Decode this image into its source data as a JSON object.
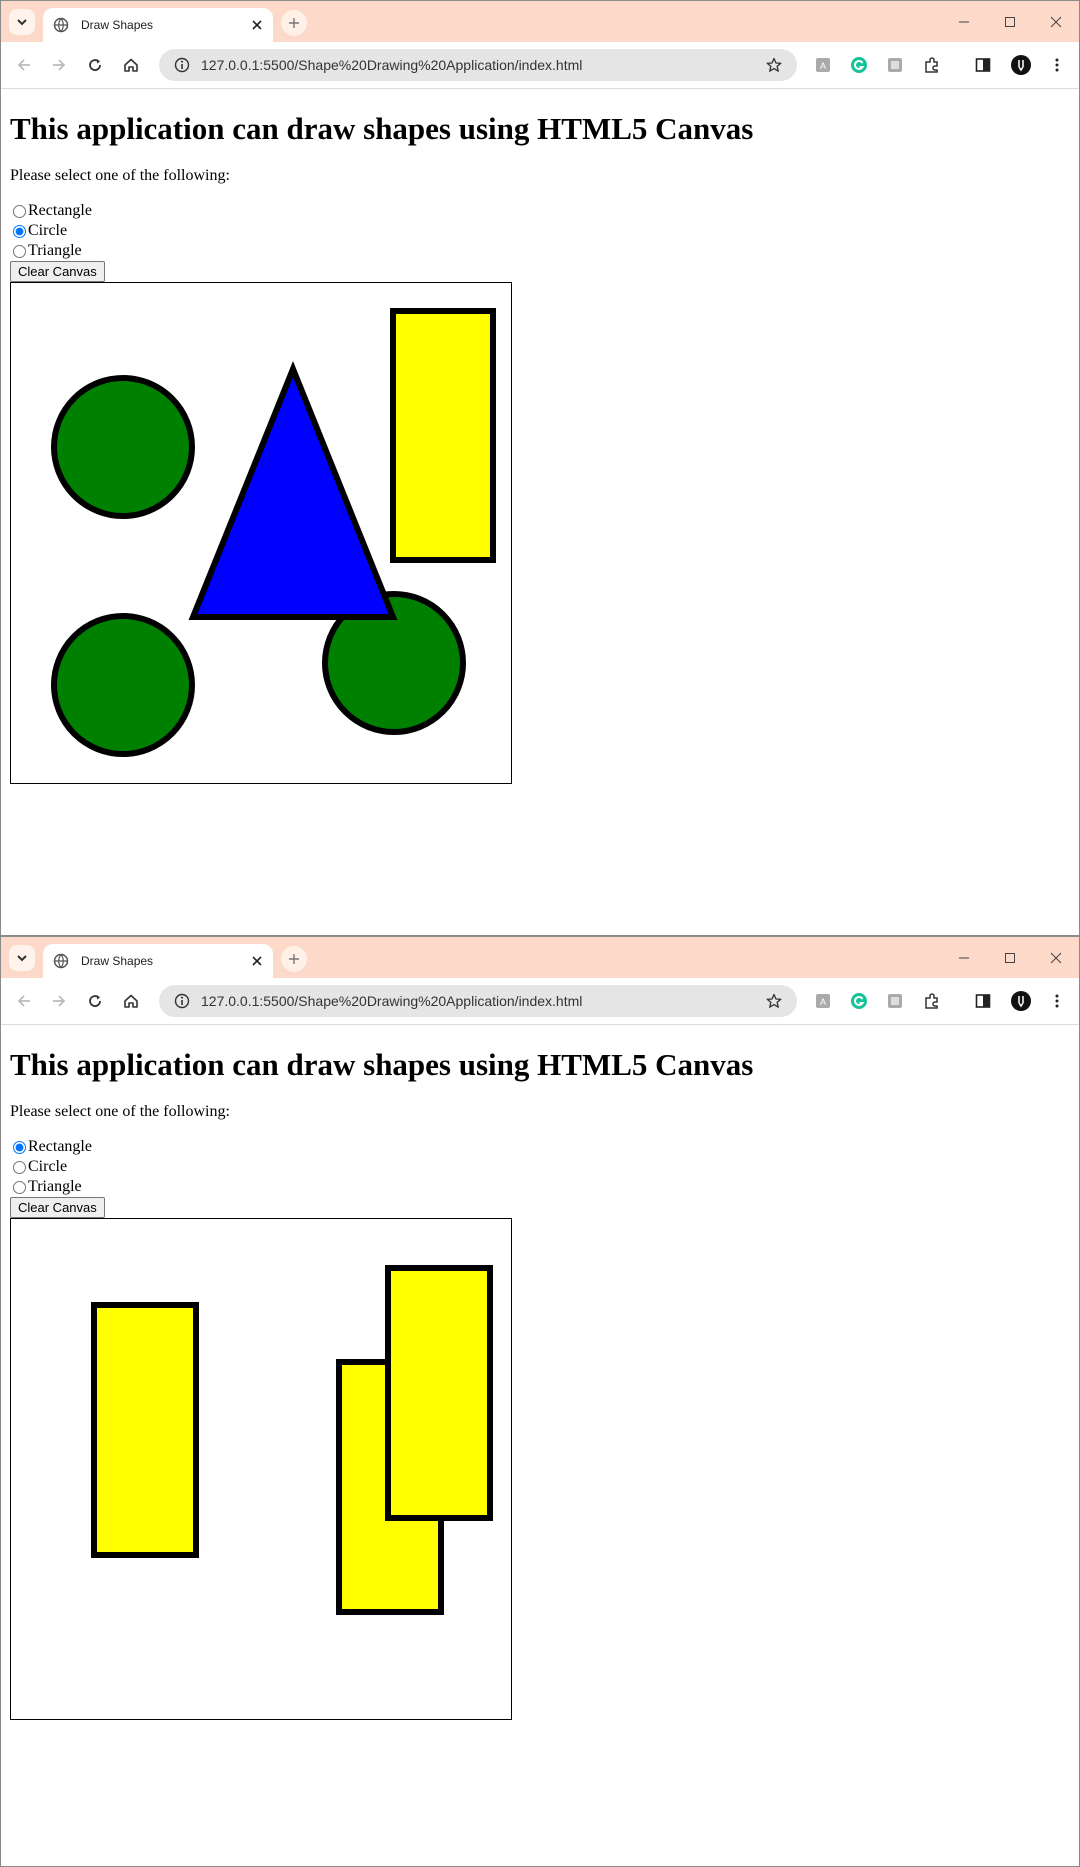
{
  "windows": [
    {
      "tab_title": "Draw Shapes",
      "url": "127.0.0.1:5500/Shape%20Drawing%20Application/index.html",
      "heading": "This application can draw shapes using HTML5 Canvas",
      "prompt": "Please select one of the following:",
      "options": [
        "Rectangle",
        "Circle",
        "Triangle"
      ],
      "selected": "Circle",
      "clear_label": "Clear Canvas"
    },
    {
      "tab_title": "Draw Shapes",
      "url": "127.0.0.1:5500/Shape%20Drawing%20Application/index.html",
      "heading": "This application can draw shapes using HTML5 Canvas",
      "prompt": "Please select one of the following:",
      "options": [
        "Rectangle",
        "Circle",
        "Triangle"
      ],
      "selected": "Rectangle",
      "clear_label": "Clear Canvas"
    }
  ],
  "colors": {
    "tabbar": "#fcd9c8",
    "circle_fill": "#008000",
    "triangle_fill": "#0000ff",
    "rectangle_fill": "#ffff00",
    "stroke": "#000000"
  },
  "icons": [
    "chevron-down-icon",
    "globe-icon",
    "close-icon",
    "plus-icon",
    "minimize-icon",
    "maximize-icon",
    "window-close-icon",
    "back-arrow-icon",
    "forward-arrow-icon",
    "reload-icon",
    "home-icon",
    "info-icon",
    "star-icon",
    "extension-icon",
    "grammarly-icon",
    "puzzle-icon",
    "sidepanel-icon",
    "profile-avatar-icon",
    "kebab-menu-icon"
  ]
}
